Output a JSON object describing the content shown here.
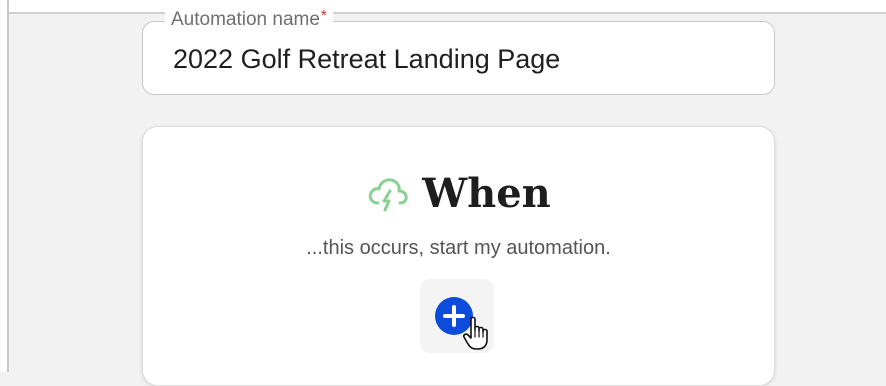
{
  "automation_name": {
    "label": "Automation name",
    "required_mark": "*",
    "value": "2022 Golf Retreat Landing Page"
  },
  "trigger_card": {
    "icon": "cloud-lightning-icon",
    "icon_color": "#8bcf93",
    "title": "When",
    "subtitle": "...this occurs, start my automation.",
    "add_button_icon": "plus-circle-icon",
    "add_button_color": "#0b4cdb"
  }
}
